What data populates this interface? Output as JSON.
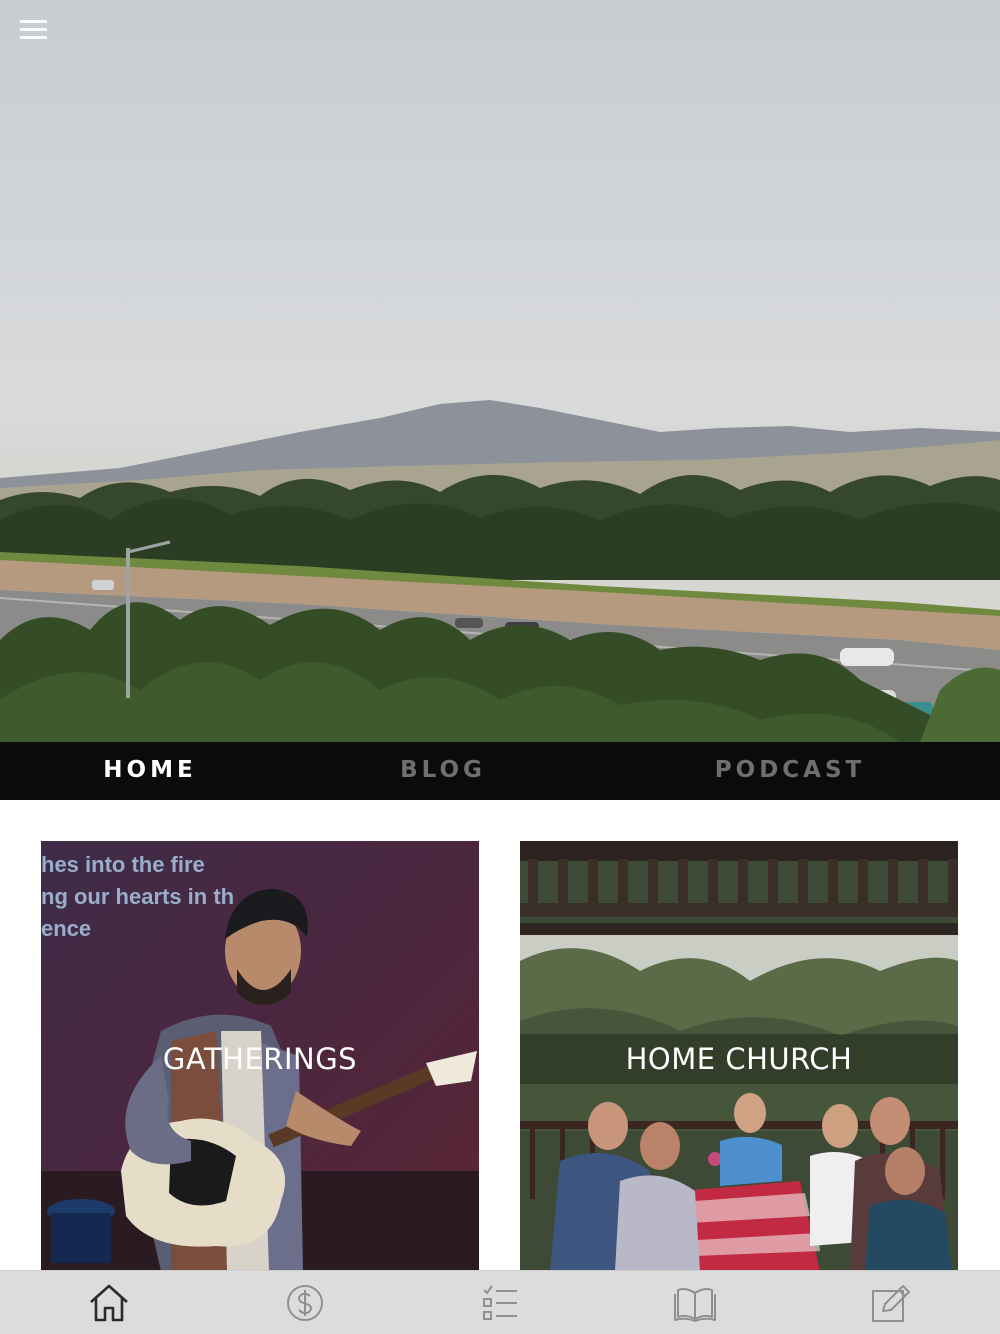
{
  "hero": {
    "menu_icon": "hamburger-menu-icon"
  },
  "top_nav": {
    "tabs": [
      {
        "label": "HOME",
        "active": true
      },
      {
        "label": "BLOG",
        "active": false
      },
      {
        "label": "PODCAST",
        "active": false
      }
    ]
  },
  "cards": [
    {
      "label": "GATHERINGS",
      "slide_lines": [
        "hes into the fire",
        "ng our hearts in th",
        "ence"
      ]
    },
    {
      "label": "HOME CHURCH"
    }
  ],
  "bottom_bar": {
    "items": [
      {
        "icon": "home-icon",
        "active": true
      },
      {
        "icon": "dollar-circle-icon",
        "active": false
      },
      {
        "icon": "checklist-icon",
        "active": false
      },
      {
        "icon": "open-book-icon",
        "active": false
      },
      {
        "icon": "edit-note-icon",
        "active": false
      }
    ]
  },
  "colors": {
    "nav_background": "#0b0b0b",
    "nav_active": "#ffffff",
    "nav_inactive": "#6f6f6f",
    "bottom_bar_background": "#dcdcdc",
    "icon_active": "#2b2b2b",
    "icon_inactive": "#8f8f8f"
  }
}
